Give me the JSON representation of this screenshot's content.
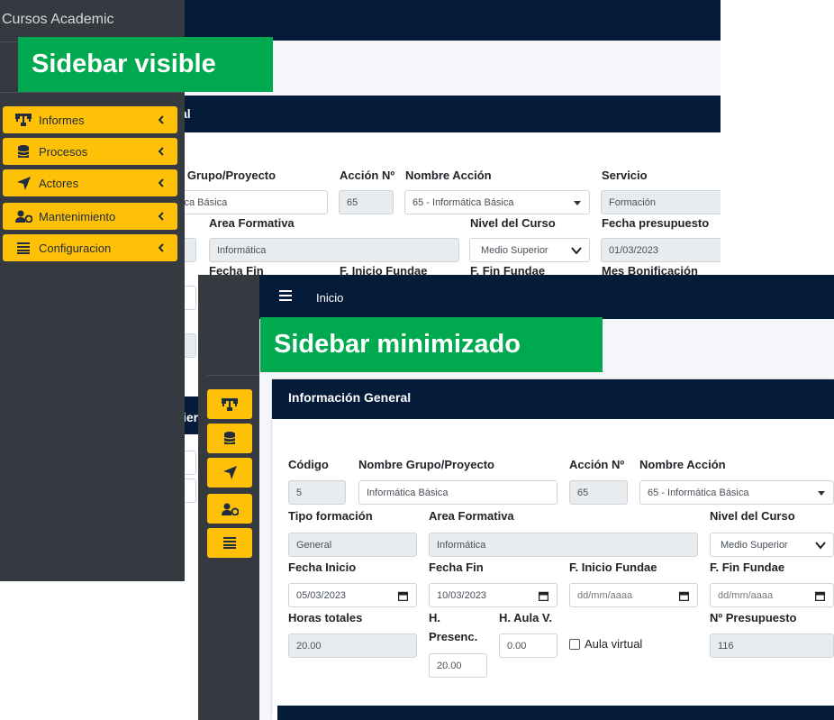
{
  "banners": {
    "visible": "Sidebar visible",
    "minimized": "Sidebar minimizado"
  },
  "colors": {
    "navy": "#041b3a",
    "sidebar": "#343a40",
    "accent": "#ffc107",
    "banner": "#00a94f"
  },
  "panel_visible": {
    "brand": "Cursos Academic",
    "card_title_partial": "al",
    "menu": [
      {
        "label": "Informes",
        "icon": "sitemap-icon"
      },
      {
        "label": "Procesos",
        "icon": "database-icon"
      },
      {
        "label": "Actores",
        "icon": "location-arrow-icon"
      },
      {
        "label": "Mantenimiento",
        "icon": "users-cog-icon"
      },
      {
        "label": "Configuracion",
        "icon": "list-icon"
      }
    ],
    "labels": {
      "grupo": "e Grupo/Proyecto",
      "accion": "Acción Nº",
      "nombre_accion": "Nombre Acción",
      "servicio": "Servicio",
      "area": "Area Formativa",
      "nivel": "Nivel del Curso",
      "fecha_presupuesto": "Fecha presupuesto",
      "fecha_fin": "Fecha Fin",
      "inicio_fundae": "F. Inicio Fundae",
      "fin_fundae": "F. Fin Fundae",
      "mes_bonificacion": "Mes Bonificación",
      "partial_cier": "ier"
    },
    "values": {
      "grupo": "tica Básica",
      "accion": "65",
      "nombre_accion": "65 - Informática Básica",
      "servicio": "Formación",
      "area": "Informática",
      "nivel": "Medio Superior",
      "fecha_presupuesto": "01/03/2023",
      "partial_s1": "s",
      "partial_s2": "s"
    }
  },
  "panel_min": {
    "topbar_title": "Inicio",
    "card_title": "Información General",
    "labels": {
      "codigo": "Código",
      "nombre_grupo": "Nombre Grupo/Proyecto",
      "accion": "Acción Nº",
      "nombre_accion": "Nombre Acción",
      "tipo_formacion": "Tipo formación",
      "area": "Area Formativa",
      "nivel": "Nivel del Curso",
      "fecha_inicio": "Fecha Inicio",
      "fecha_fin": "Fecha Fin",
      "inicio_fundae": "F. Inicio Fundae",
      "fin_fundae": "F. Fin Fundae",
      "horas_totales": "Horas totales",
      "h_presenc_1": "H.",
      "h_presenc_2": "Presenc.",
      "h_aula": "H. Aula V.",
      "aula_virtual": "Aula virtual",
      "presupuesto": "Nº Presupuesto"
    },
    "values": {
      "codigo": "5",
      "nombre_grupo": "Informática Básica",
      "accion": "65",
      "nombre_accion": "65 - Informática Básica",
      "tipo_formacion": "General",
      "area": "Informática",
      "nivel": "Medio Superior",
      "fecha_inicio": "05/03/2023",
      "fecha_fin": "10/03/2023",
      "inicio_fundae_placeholder": "dd/mm/aaaa",
      "fin_fundae_placeholder": "dd/mm/aaaa",
      "horas_totales": "20.00",
      "h_presenc": "20.00",
      "h_aula": "0.00",
      "presupuesto": "116"
    }
  }
}
